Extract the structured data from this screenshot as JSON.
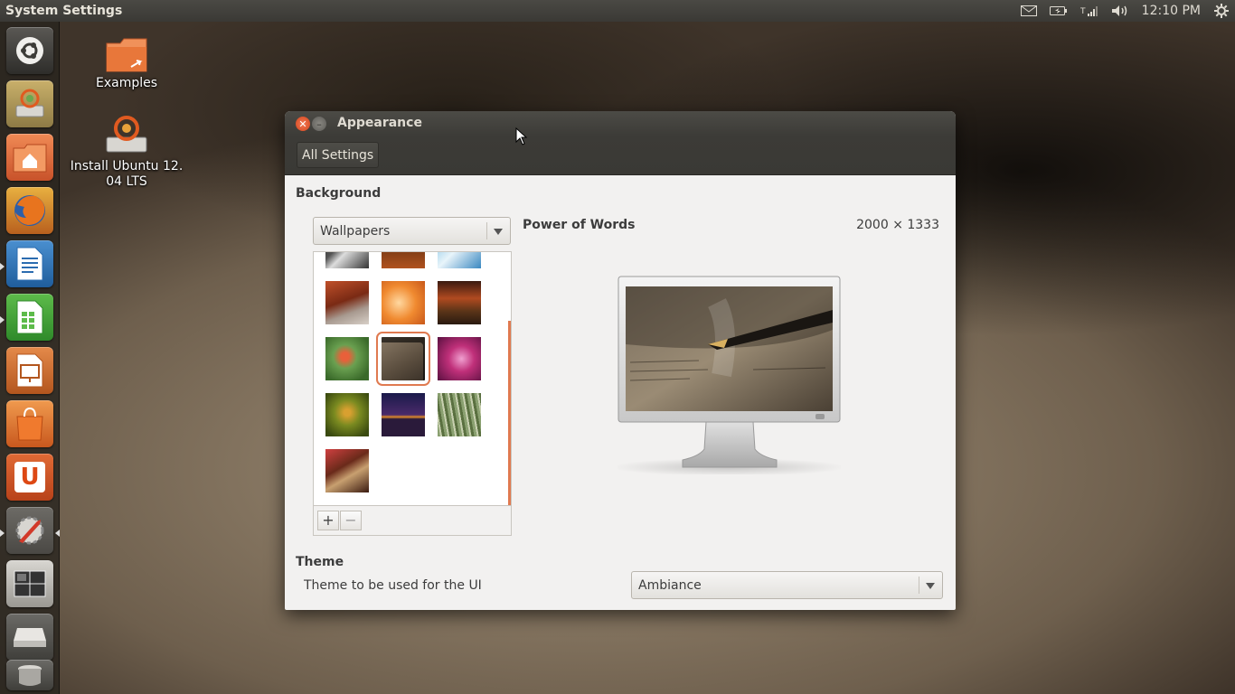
{
  "top_panel": {
    "app_title": "System Settings",
    "clock": "12:10 PM",
    "indicators": [
      "mail-icon",
      "battery-icon",
      "network-icon",
      "volume-icon",
      "session-gear-icon"
    ]
  },
  "launcher": {
    "items": [
      {
        "name": "dash-home",
        "icon": "ubuntu-logo-icon"
      },
      {
        "name": "ubuntu-installer",
        "icon": "installer-icon"
      },
      {
        "name": "home-folder",
        "icon": "home-folder-icon"
      },
      {
        "name": "firefox",
        "icon": "firefox-icon"
      },
      {
        "name": "libreoffice-writer",
        "icon": "writer-icon"
      },
      {
        "name": "libreoffice-calc",
        "icon": "calc-icon"
      },
      {
        "name": "libreoffice-impress",
        "icon": "impress-icon"
      },
      {
        "name": "software-center",
        "icon": "shopping-bag-icon"
      },
      {
        "name": "ubuntu-one",
        "icon": "ubuntu-one-icon"
      },
      {
        "name": "system-settings",
        "icon": "settings-wrench-icon"
      },
      {
        "name": "workspace-switcher",
        "icon": "workspaces-icon"
      },
      {
        "name": "drive",
        "icon": "drive-icon"
      },
      {
        "name": "trash",
        "icon": "trash-icon"
      }
    ]
  },
  "desktop": {
    "icons": [
      {
        "label": "Examples",
        "icon": "folder-link-icon"
      },
      {
        "label": "Install Ubuntu 12.\n04 LTS",
        "icon": "installer-icon"
      }
    ]
  },
  "window": {
    "title": "Appearance",
    "all_settings_label": "All Settings",
    "background_section_title": "Background",
    "background_source": "Wallpapers",
    "preview": {
      "title": "Power of Words",
      "size": "2000 × 1333"
    },
    "add_button": "+",
    "remove_button": "−",
    "theme_section_title": "Theme",
    "theme_label": "Theme to be used for the UI",
    "theme_value": "Ambiance"
  },
  "colors": {
    "accent": "#e07a50",
    "panel": "#3c3b37",
    "window_bg": "#f2f1f0"
  }
}
